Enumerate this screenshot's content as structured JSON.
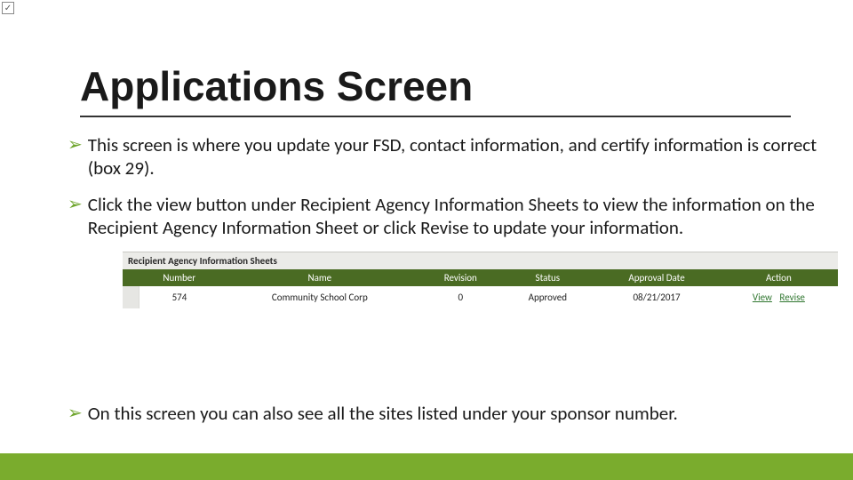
{
  "corner_icon": "✓",
  "title": "Applications Screen",
  "bullets": [
    "This screen is where you update your FSD, contact information, and certify information is correct (box 29).",
    "Click the view button under Recipient Agency Information Sheets to view the information on the Recipient Agency Information Sheet  or click Revise to update your information."
  ],
  "table": {
    "caption": "Recipient Agency Information Sheets",
    "headers": [
      "Number",
      "Name",
      "Revision",
      "Status",
      "Approval Date",
      "Action"
    ],
    "row": {
      "number": "574",
      "name": "Community School Corp",
      "revision": "0",
      "status": "Approved",
      "approval_date": "08/21/2017",
      "action_view": "View",
      "action_revise": "Revise"
    }
  },
  "bullet_after_table": "On this screen you can also see all the sites listed under your sponsor number."
}
